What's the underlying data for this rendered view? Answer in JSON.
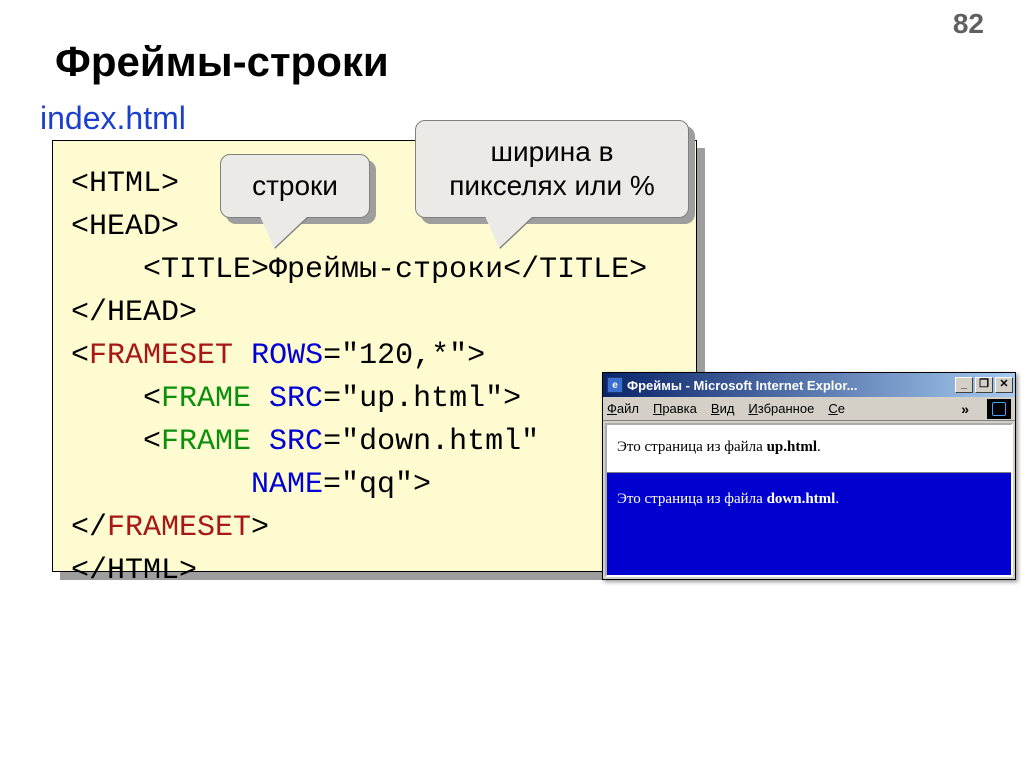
{
  "page_num": "82",
  "title": "Фреймы-строки",
  "filename": "index.html",
  "callouts": {
    "rows": "строки",
    "width": "ширина в пикселях или %"
  },
  "code": {
    "l1a": "<HTML>",
    "l2a": "<HEAD>",
    "l3a": "    <TITLE>Фреймы-строки</TITLE>",
    "l4a": "</HEAD>",
    "l5_open": "<",
    "l5_frameset": "FRAMESET",
    "l5_sp": " ",
    "l5_rows": "ROWS",
    "l5_val": "=\"120,*\">",
    "l6_pre": "    <",
    "l6_frame": "FRAME",
    "l6_sp": " ",
    "l6_src": "SRC",
    "l6_val": "=\"up.html\">",
    "l7_pre": "    <",
    "l7_frame": "FRAME",
    "l7_sp": " ",
    "l7_src": "SRC",
    "l7_val": "=\"down.html\"",
    "l8_pre": "          ",
    "l8_name": "NAME",
    "l8_val": "=\"qq\">",
    "l9_open": "</",
    "l9_frameset": "FRAMESET",
    "l9_close": ">",
    "l10": "</HTML>"
  },
  "browser": {
    "title": "Фреймы - Microsoft Internet Explor...",
    "btn_min": "_",
    "btn_max": "❐",
    "btn_close": "✕",
    "menu": {
      "file": "Файл",
      "edit": "Правка",
      "view": "Вид",
      "fav": "Избранное",
      "serv": "Се",
      "more": "»"
    },
    "top_text_a": "Это страница из файла ",
    "top_text_b": "up.html",
    "top_text_c": ".",
    "bottom_text_a": "Это страница из файла ",
    "bottom_text_b": "down.html",
    "bottom_text_c": "."
  }
}
